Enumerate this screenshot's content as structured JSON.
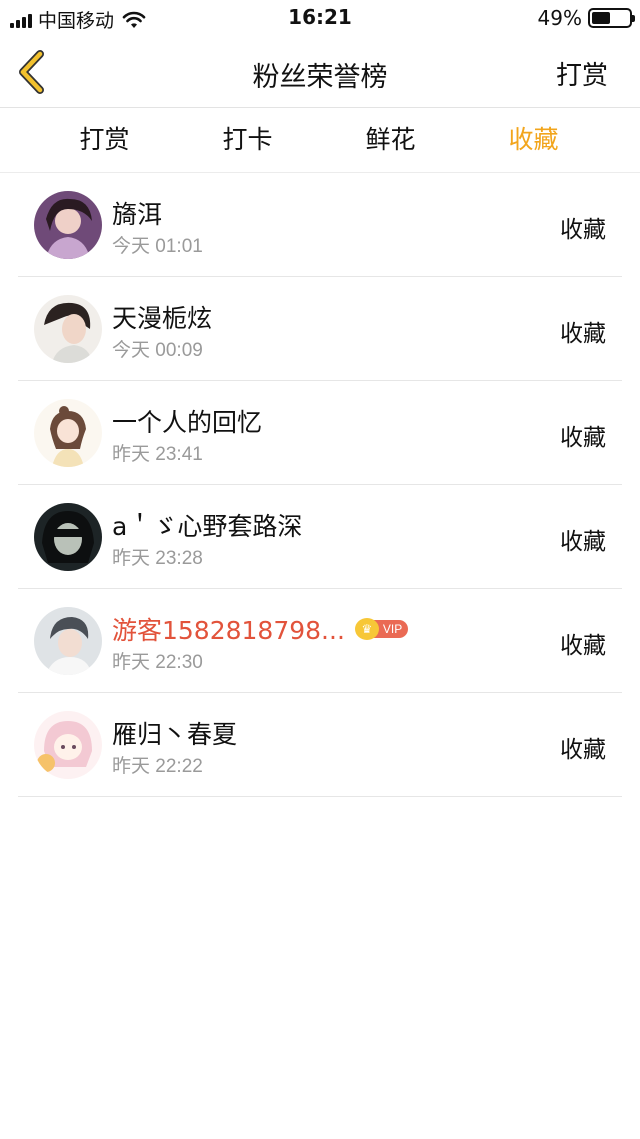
{
  "status_bar": {
    "carrier": "中国移动",
    "time": "16:21",
    "battery": "49%",
    "battery_level": 0.49
  },
  "nav": {
    "back_icon": "chevron-left-icon",
    "title": "粉丝荣誉榜",
    "action": "打赏",
    "back_color": "#f2c12e"
  },
  "tabs": [
    {
      "label": "打赏",
      "active": false
    },
    {
      "label": "打卡",
      "active": false
    },
    {
      "label": "鲜花",
      "active": false
    },
    {
      "label": "收藏",
      "active": true
    }
  ],
  "accent_color": "#f2a51c",
  "fans": [
    {
      "name": "旖洱",
      "time": "今天 01:01",
      "action": "收藏",
      "vip": false
    },
    {
      "name": "天漫栀炫",
      "time": "今天 00:09",
      "action": "收藏",
      "vip": false
    },
    {
      "name": "一个人的回忆",
      "time": "昨天 23:41",
      "action": "收藏",
      "vip": false
    },
    {
      "name": "a＇ゞ心野套路深",
      "time": "昨天 23:28",
      "action": "收藏",
      "vip": false
    },
    {
      "name": "游客1582818798...",
      "time": "昨天 22:30",
      "action": "收藏",
      "vip": true,
      "vip_label": "VIP"
    },
    {
      "name": "雁归丶春夏",
      "time": "昨天 22:22",
      "action": "收藏",
      "vip": false
    }
  ]
}
